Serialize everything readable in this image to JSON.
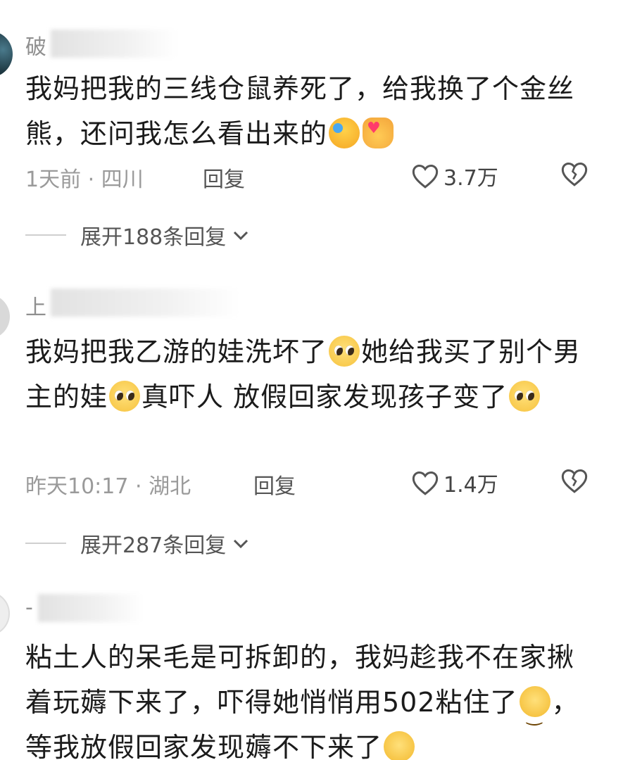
{
  "comments": [
    {
      "username": "破",
      "text_a": "我妈把我的三线仓鼠养死了，给我换了个金丝熊，还问我怎么看出来的",
      "emojis": [
        "rolling-laughing-emoji",
        "heart-hand-emoji"
      ],
      "time": "1天前 · 四川",
      "reply_label": "回复",
      "likes": "3.7万",
      "expand_label": "展开188条回复"
    },
    {
      "username": "上",
      "text_a": "我妈把我乙游的娃洗坏了",
      "text_b": "她给我买了别个男主的娃",
      "text_c": "真吓人 放假回家发现孩子变了",
      "emojis": [
        "pleading-face-emoji"
      ],
      "time": "昨天10:17 · 湖北",
      "reply_label": "回复",
      "likes": "1.4万",
      "expand_label": "展开287条回复"
    },
    {
      "username": "-",
      "text_a": "粘土人的呆毛是可拆卸的，我妈趁我不在家揪着玩薅下来了，吓得她悄悄用502粘住了",
      "text_b": "，等我放假回家发现薅不下来了",
      "emojis": [
        "smiling-face-emoji"
      ]
    }
  ],
  "colors": {
    "text": "#1b1b1b",
    "meta": "#9a9a9a",
    "link": "#555555",
    "divider": "#cfcfcf"
  }
}
